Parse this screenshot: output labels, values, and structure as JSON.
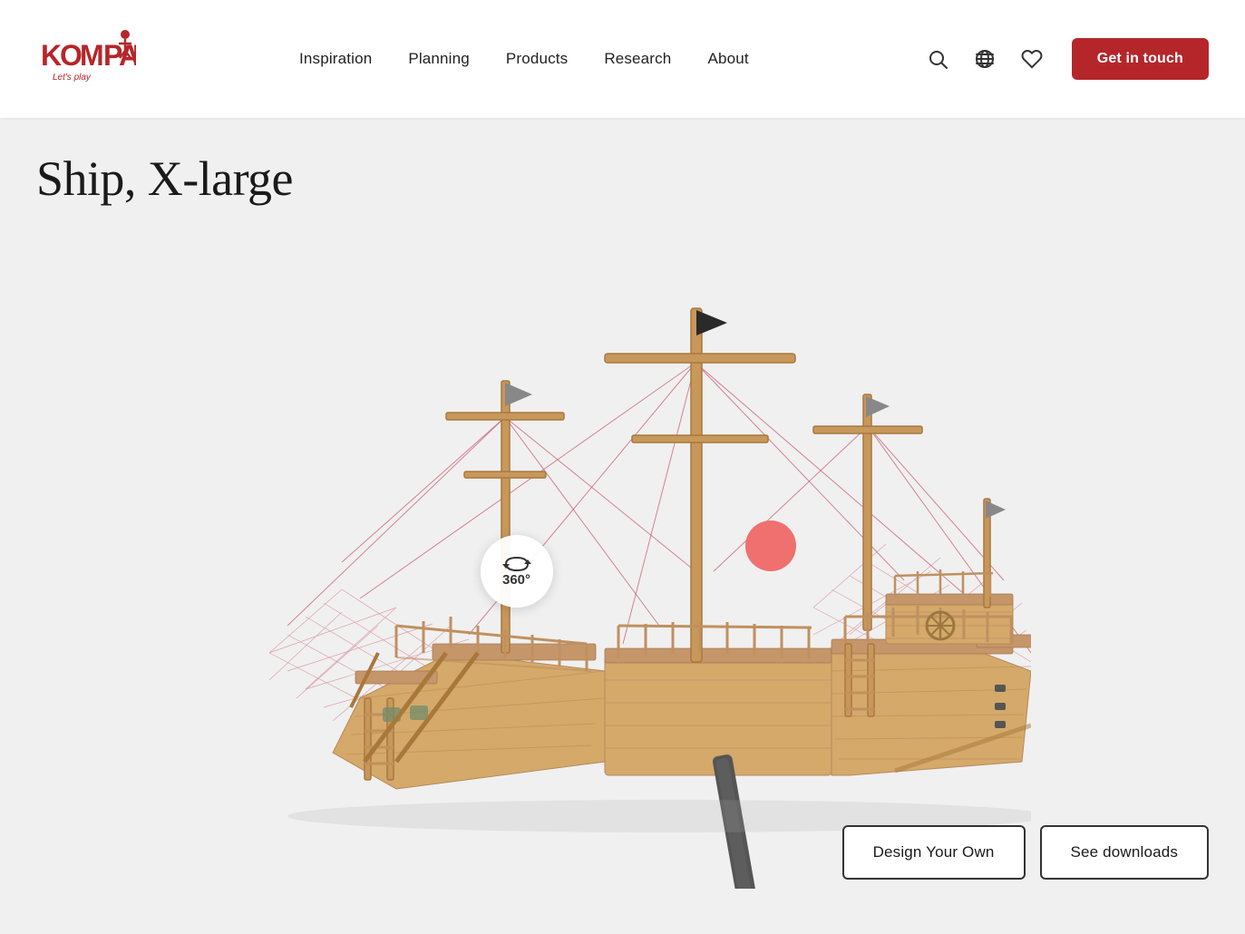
{
  "header": {
    "logo_text": "KOMPAN",
    "logo_tagline": "Let's play",
    "nav_items": [
      {
        "label": "Inspiration",
        "id": "inspiration"
      },
      {
        "label": "Planning",
        "id": "planning"
      },
      {
        "label": "Products",
        "id": "products"
      },
      {
        "label": "Research",
        "id": "research"
      },
      {
        "label": "About",
        "id": "about"
      }
    ],
    "cta_button": "Get in touch"
  },
  "main": {
    "page_title": "Ship, X-large",
    "badge_360": "360°",
    "badge_rotate_label": "360°"
  },
  "footer_buttons": {
    "design_your_own": "Design Your Own",
    "see_downloads": "See downloads"
  },
  "colors": {
    "brand_red": "#b5262a",
    "hotspot_coral": "#f07070",
    "rope_pink": "#c8536a",
    "wood_tan": "#d4a96a"
  }
}
